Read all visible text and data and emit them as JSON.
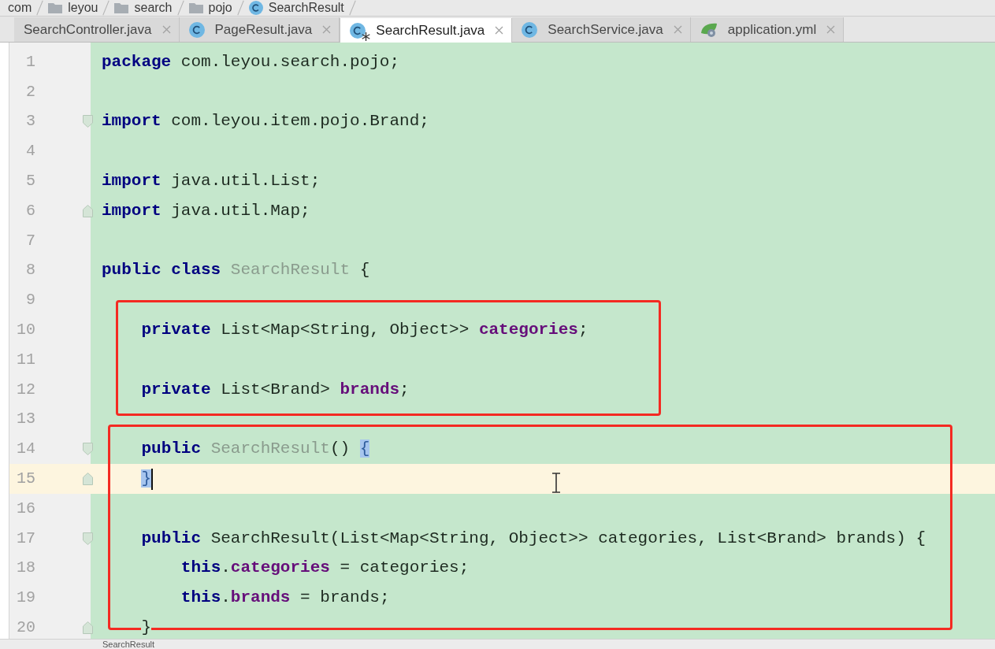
{
  "breadcrumbs": [
    {
      "label": "com",
      "kind": "text"
    },
    {
      "label": "leyou",
      "kind": "folder"
    },
    {
      "label": "search",
      "kind": "folder"
    },
    {
      "label": "pojo",
      "kind": "folder"
    },
    {
      "label": "SearchResult",
      "kind": "class"
    }
  ],
  "tabs": [
    {
      "label": "SearchController.java",
      "kind": "text",
      "selected": false,
      "modified": false
    },
    {
      "label": "PageResult.java",
      "kind": "class",
      "selected": false,
      "modified": false
    },
    {
      "label": "SearchResult.java",
      "kind": "class",
      "selected": true,
      "modified": true
    },
    {
      "label": "SearchService.java",
      "kind": "class",
      "selected": false,
      "modified": false
    },
    {
      "label": "application.yml",
      "kind": "config",
      "selected": false,
      "modified": false
    }
  ],
  "editor": {
    "lines": [
      {
        "number": "1",
        "current": false,
        "fold_start": false,
        "fold_end": false,
        "tokens": [
          {
            "kind": "keyword",
            "text": "package"
          },
          {
            "kind": "plain",
            "text": " com.leyou.search.pojo;"
          }
        ]
      },
      {
        "number": "2",
        "current": false,
        "fold_start": false,
        "fold_end": false
      },
      {
        "number": "3",
        "current": false,
        "fold_start": true,
        "fold_end": false,
        "tokens": [
          {
            "kind": "keyword",
            "text": "import"
          },
          {
            "kind": "plain",
            "text": " com.leyou.item.pojo.Brand;"
          }
        ]
      },
      {
        "number": "4",
        "current": false,
        "fold_start": false,
        "fold_end": false
      },
      {
        "number": "5",
        "current": false,
        "fold_start": false,
        "fold_end": false,
        "tokens": [
          {
            "kind": "keyword",
            "text": "import"
          },
          {
            "kind": "plain",
            "text": " java.util.List;"
          }
        ]
      },
      {
        "number": "6",
        "current": false,
        "fold_start": false,
        "fold_end": true,
        "tokens": [
          {
            "kind": "keyword",
            "text": "import"
          },
          {
            "kind": "plain",
            "text": " java.util.Map;"
          }
        ]
      },
      {
        "number": "7",
        "current": false,
        "fold_start": false,
        "fold_end": false
      },
      {
        "number": "8",
        "current": false,
        "fold_start": false,
        "fold_end": false,
        "tokens": [
          {
            "kind": "keyword",
            "text": "public class"
          },
          {
            "kind": "unused",
            "text": " SearchResult"
          },
          {
            "kind": "plain",
            "text": " {"
          }
        ]
      },
      {
        "number": "9",
        "current": false,
        "fold_start": false,
        "fold_end": false
      },
      {
        "number": "10",
        "current": false,
        "fold_start": false,
        "fold_end": false,
        "tokens": [
          {
            "kind": "keyword",
            "text": "    private"
          },
          {
            "kind": "plain",
            "text": " List<Map<String, Object>> "
          },
          {
            "kind": "field",
            "text": "categories"
          },
          {
            "kind": "plain",
            "text": ";"
          }
        ]
      },
      {
        "number": "11",
        "current": false,
        "fold_start": false,
        "fold_end": false
      },
      {
        "number": "12",
        "current": false,
        "fold_start": false,
        "fold_end": false,
        "tokens": [
          {
            "kind": "keyword",
            "text": "    private"
          },
          {
            "kind": "plain",
            "text": " List<Brand> "
          },
          {
            "kind": "field",
            "text": "brands"
          },
          {
            "kind": "plain",
            "text": ";"
          }
        ]
      },
      {
        "number": "13",
        "current": false,
        "fold_start": false,
        "fold_end": false
      },
      {
        "number": "14",
        "current": false,
        "fold_start": true,
        "fold_end": false,
        "tokens": [
          {
            "kind": "keyword",
            "text": "    public"
          },
          {
            "kind": "unused",
            "text": " SearchResult"
          },
          {
            "kind": "plain",
            "text": "() "
          },
          {
            "kind": "matched_brace",
            "text": "{"
          }
        ]
      },
      {
        "number": "15",
        "current": true,
        "fold_start": false,
        "fold_end": true,
        "tokens": [
          {
            "kind": "matched_brace",
            "text": "    }"
          }
        ]
      },
      {
        "number": "16",
        "current": false,
        "fold_start": false,
        "fold_end": false
      },
      {
        "number": "17",
        "current": false,
        "fold_start": true,
        "fold_end": false,
        "tokens": [
          {
            "kind": "keyword",
            "text": "    public"
          },
          {
            "kind": "plain",
            "text": " SearchResult(List<Map<String, Object>> categories, List<Brand> brands) {"
          }
        ]
      },
      {
        "number": "18",
        "current": false,
        "fold_start": false,
        "fold_end": false,
        "tokens": [
          {
            "kind": "keyword",
            "text": "        this"
          },
          {
            "kind": "plain",
            "text": "."
          },
          {
            "kind": "field",
            "text": "categories"
          },
          {
            "kind": "plain",
            "text": " = categories;"
          }
        ]
      },
      {
        "number": "19",
        "current": false,
        "fold_start": false,
        "fold_end": false,
        "tokens": [
          {
            "kind": "keyword",
            "text": "        this"
          },
          {
            "kind": "plain",
            "text": "."
          },
          {
            "kind": "field",
            "text": "brands"
          },
          {
            "kind": "plain",
            "text": " = brands;"
          }
        ]
      },
      {
        "number": "20",
        "current": false,
        "fold_start": false,
        "fold_end": true,
        "tokens": [
          {
            "kind": "plain",
            "text": "    }"
          }
        ]
      }
    ]
  },
  "bottom_bar": {
    "label": "SearchResult"
  }
}
